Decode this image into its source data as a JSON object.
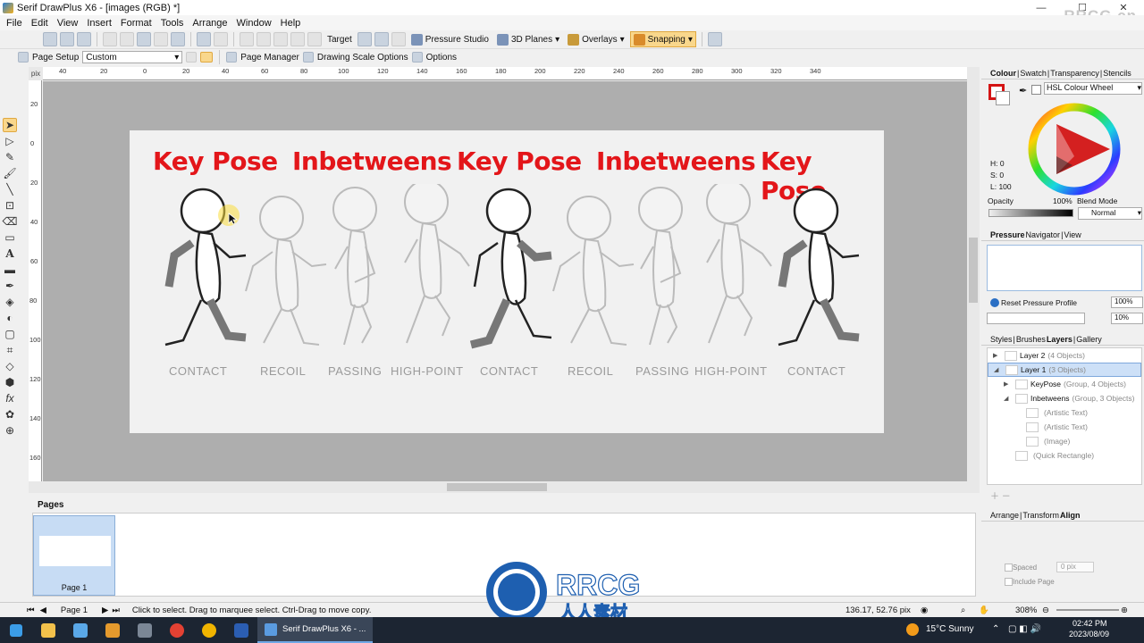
{
  "window": {
    "title": "Serif DrawPlus X6 - [images (RGB) *]",
    "controls": {
      "minimize": "—",
      "maximize": "☐",
      "close": "✕"
    },
    "watermark": "RRCG.cn"
  },
  "menu": [
    "File",
    "Edit",
    "View",
    "Insert",
    "Format",
    "Tools",
    "Arrange",
    "Window",
    "Help"
  ],
  "toolbar": {
    "target": "Target",
    "pressure_studio": "Pressure Studio",
    "planes_3d": "3D Planes",
    "overlays": "Overlays",
    "snapping": "Snapping"
  },
  "context_bar": {
    "page_setup": "Page Setup",
    "page_size_value": "Custom",
    "page_manager": "Page Manager",
    "drawing_scale": "Drawing Scale Options",
    "options": "Options"
  },
  "ruler": {
    "unit": "pix",
    "h_ticks": [
      "40",
      "20",
      "0",
      "20",
      "40",
      "60",
      "80",
      "100",
      "120",
      "140",
      "160",
      "180",
      "200",
      "220",
      "240",
      "260",
      "280",
      "300",
      "320",
      "340"
    ],
    "v_ticks": [
      "20",
      "0",
      "20",
      "40",
      "60",
      "80",
      "100",
      "120",
      "140",
      "160"
    ]
  },
  "artwork": {
    "titles": [
      "Key Pose",
      "Inbetweens",
      "Key Pose",
      "Inbetweens",
      "Key Pose"
    ],
    "phases": [
      "CONTACT",
      "RECOIL",
      "PASSING",
      "HIGH-POINT",
      "CONTACT",
      "RECOIL",
      "PASSING",
      "HIGH-POINT",
      "CONTACT"
    ],
    "key_color": "#e3161a"
  },
  "pages_panel": {
    "title": "Pages",
    "page_label": "Page 1"
  },
  "status": {
    "page": "Page 1",
    "hint": "Click to select. Drag to marquee select. Ctrl-Drag to move copy.",
    "coords": "136.17, 52.76 pix",
    "zoom": "308%"
  },
  "colour_panel": {
    "tabs": [
      "Colour",
      "Swatch",
      "Transparency",
      "Stencils"
    ],
    "mode": "HSL Colour Wheel",
    "h": "H: 0",
    "s": "S: 0",
    "l": "L: 100",
    "opacity_label": "Opacity",
    "opacity_value": "100%",
    "blend_label": "Blend Mode",
    "blend_value": "Normal"
  },
  "pressure_panel": {
    "tabs": [
      "Pressure",
      "Navigator",
      "View"
    ],
    "reset": "Reset Pressure Profile",
    "val1": "100%",
    "val2": "10%"
  },
  "layers_panel": {
    "tabs": [
      "Styles",
      "Brushes",
      "Layers",
      "Gallery"
    ],
    "layers": [
      {
        "name": "Layer 2",
        "detail": "(4 Objects)",
        "indent": 0,
        "selected": false
      },
      {
        "name": "Layer 1",
        "detail": "(3 Objects)",
        "indent": 0,
        "selected": true
      },
      {
        "name": "KeyPose",
        "detail": "(Group, 4 Objects)",
        "indent": 1,
        "selected": false
      },
      {
        "name": "Inbetweens",
        "detail": "(Group, 3 Objects)",
        "indent": 1,
        "selected": false
      },
      {
        "name": "",
        "detail": "(Artistic Text)",
        "indent": 2,
        "selected": false
      },
      {
        "name": "",
        "detail": "(Artistic Text)",
        "indent": 2,
        "selected": false
      },
      {
        "name": "",
        "detail": "(Image)",
        "indent": 2,
        "selected": false
      },
      {
        "name": "",
        "detail": "(Quick Rectangle)",
        "indent": 1,
        "selected": false
      }
    ]
  },
  "align_panel": {
    "tabs": [
      "Arrange",
      "Transform",
      "Align"
    ],
    "spaced_label": "Spaced",
    "spaced_value": "0 pix",
    "include_page": "Include Page"
  },
  "taskbar": {
    "running_app": "Serif DrawPlus X6 - ...",
    "weather": "15°C  Sunny",
    "time": "02:42 PM",
    "date": "2023/08/09"
  },
  "rrcg_logo": {
    "brand": "RRCG",
    "sub": "人人素材"
  }
}
